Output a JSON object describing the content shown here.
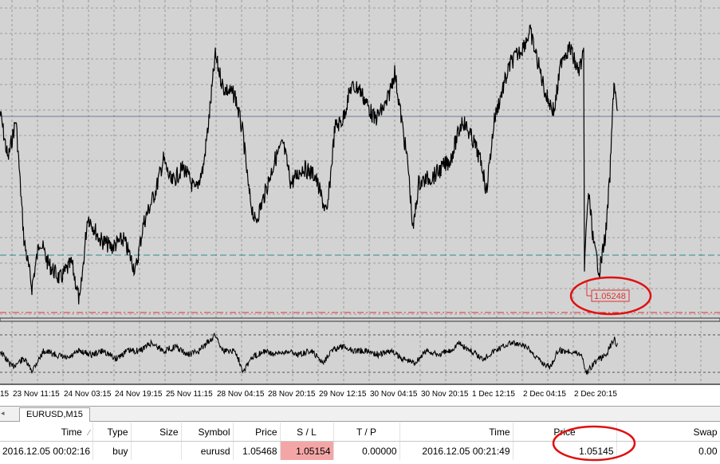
{
  "chart": {
    "price_marker": "1.05248",
    "x_labels": [
      "15",
      "23 Nov 11:15",
      "24 Nov 03:15",
      "24 Nov 19:15",
      "25 Nov 11:15",
      "28 Nov 04:15",
      "28 Nov 20:15",
      "29 Nov 12:15",
      "30 Nov 04:15",
      "30 Nov 20:15",
      "1 Dec 12:15",
      "2 Dec 04:15",
      "2 Dec 20:15"
    ],
    "colors": {
      "background": "#d3d3d3",
      "grid": "#8a8a8a",
      "price_line": "#000000",
      "sl_line": "#e03030",
      "tp_line": "#2e8b8b",
      "marker_box": "#e03030",
      "annotation": "#e01010"
    }
  },
  "tabs": {
    "active": "EURUSD,M15"
  },
  "trades": {
    "headers": {
      "time": "Time",
      "type": "Type",
      "size": "Size",
      "symbol": "Symbol",
      "price": "Price",
      "sl": "S / L",
      "tp": "T / P",
      "close_time": "Time",
      "close_price": "Price",
      "swap": "Swap"
    },
    "rows": [
      {
        "time": "2016.12.05 00:02:16",
        "type": "buy",
        "size": "",
        "symbol": "eurusd",
        "price": "1.05468",
        "sl": "1.05154",
        "tp": "0.00000",
        "close_time": "2016.12.05 00:21:49",
        "close_price": "1.05145",
        "swap": "0.00"
      }
    ]
  }
}
